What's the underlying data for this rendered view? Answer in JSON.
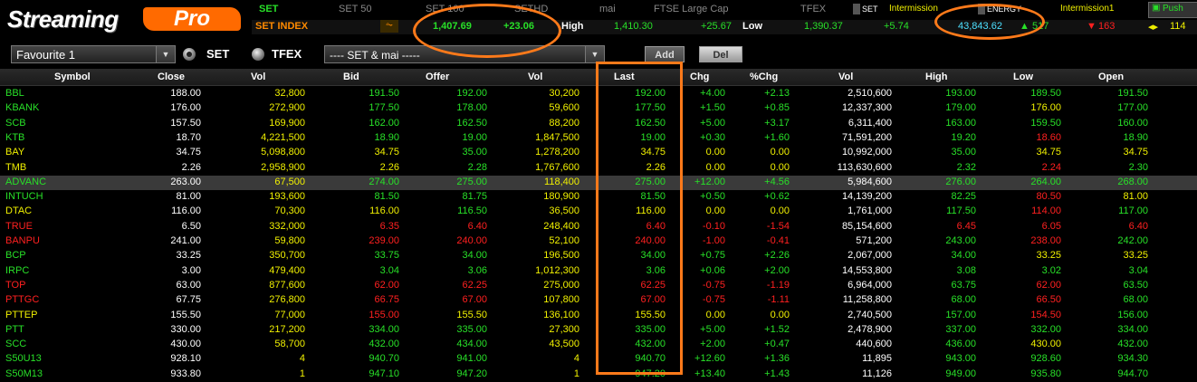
{
  "logo": {
    "word1": "Streaming",
    "word2": "Pro"
  },
  "index_tabs": [
    "SET",
    "SET 50",
    "SET 100",
    "SETHD",
    "mai",
    "FTSE Large Cap",
    "TFEX"
  ],
  "status_bar": {
    "set_label": "SET",
    "set_status": "Intermission",
    "sector_label": "ENERGY",
    "sector_status": "Intermission1",
    "push_label": "Push"
  },
  "index_row": {
    "name": "SET INDEX",
    "chart_icon": "line-chart-icon",
    "value": "1,407.69",
    "change": "+23.06",
    "high_label": "High",
    "high": "1,410.30",
    "high_chg": "+25.67",
    "low_label": "Low",
    "low": "1,390.37",
    "low_chg": "+5.74",
    "volume": "43,843.62",
    "up": "517",
    "down": "163",
    "unchanged": "114"
  },
  "controls": {
    "favourite": "Favourite 1",
    "radio_set": "SET",
    "radio_tfex": "TFEX",
    "market_filter": "---- SET & mai -----",
    "add": "Add",
    "del": "Del"
  },
  "columns": [
    "Symbol",
    "Close",
    "Vol",
    "Bid",
    "Offer",
    "Vol",
    "Last",
    "Chg",
    "%Chg",
    "Vol",
    "High",
    "Low",
    "Open"
  ],
  "rows": [
    [
      "BBL",
      "188.00",
      "32,800",
      "191.50",
      "192.00",
      "30,200",
      "192.00",
      "+4.00",
      "+2.13",
      "2,510,600",
      "193.00",
      "189.50",
      "191.50"
    ],
    [
      "KBANK",
      "176.00",
      "272,900",
      "177.50",
      "178.00",
      "59,600",
      "177.50",
      "+1.50",
      "+0.85",
      "12,337,300",
      "179.00",
      "176.00",
      "177.00"
    ],
    [
      "SCB",
      "157.50",
      "169,900",
      "162.00",
      "162.50",
      "88,200",
      "162.50",
      "+5.00",
      "+3.17",
      "6,311,400",
      "163.00",
      "159.50",
      "160.00"
    ],
    [
      "KTB",
      "18.70",
      "4,221,500",
      "18.90",
      "19.00",
      "1,847,500",
      "19.00",
      "+0.30",
      "+1.60",
      "71,591,200",
      "19.20",
      "18.60",
      "18.90"
    ],
    [
      "BAY",
      "34.75",
      "5,098,800",
      "34.75",
      "35.00",
      "1,278,200",
      "34.75",
      "0.00",
      "0.00",
      "10,992,000",
      "35.00",
      "34.75",
      "34.75"
    ],
    [
      "TMB",
      "2.26",
      "2,958,900",
      "2.26",
      "2.28",
      "1,767,600",
      "2.26",
      "0.00",
      "0.00",
      "113,630,600",
      "2.32",
      "2.24",
      "2.30"
    ],
    [
      "ADVANC",
      "263.00",
      "67,500",
      "274.00",
      "275.00",
      "118,400",
      "275.00",
      "+12.00",
      "+4.56",
      "5,984,600",
      "276.00",
      "264.00",
      "268.00"
    ],
    [
      "INTUCH",
      "81.00",
      "193,600",
      "81.50",
      "81.75",
      "180,900",
      "81.50",
      "+0.50",
      "+0.62",
      "14,139,200",
      "82.25",
      "80.50",
      "81.00"
    ],
    [
      "DTAC",
      "116.00",
      "70,300",
      "116.00",
      "116.50",
      "36,500",
      "116.00",
      "0.00",
      "0.00",
      "1,761,000",
      "117.50",
      "114.00",
      "117.00"
    ],
    [
      "TRUE",
      "6.50",
      "332,000",
      "6.35",
      "6.40",
      "248,400",
      "6.40",
      "-0.10",
      "-1.54",
      "85,154,600",
      "6.45",
      "6.05",
      "6.40"
    ],
    [
      "BANPU",
      "241.00",
      "59,800",
      "239.00",
      "240.00",
      "52,100",
      "240.00",
      "-1.00",
      "-0.41",
      "571,200",
      "243.00",
      "238.00",
      "242.00"
    ],
    [
      "BCP",
      "33.25",
      "350,700",
      "33.75",
      "34.00",
      "196,500",
      "34.00",
      "+0.75",
      "+2.26",
      "2,067,000",
      "34.00",
      "33.25",
      "33.25"
    ],
    [
      "IRPC",
      "3.00",
      "479,400",
      "3.04",
      "3.06",
      "1,012,300",
      "3.06",
      "+0.06",
      "+2.00",
      "14,553,800",
      "3.08",
      "3.02",
      "3.04"
    ],
    [
      "TOP",
      "63.00",
      "877,600",
      "62.00",
      "62.25",
      "275,000",
      "62.25",
      "-0.75",
      "-1.19",
      "6,964,000",
      "63.75",
      "62.00",
      "63.50"
    ],
    [
      "PTTGC",
      "67.75",
      "276,800",
      "66.75",
      "67.00",
      "107,800",
      "67.00",
      "-0.75",
      "-1.11",
      "11,258,800",
      "68.00",
      "66.50",
      "68.00"
    ],
    [
      "PTTEP",
      "155.50",
      "77,000",
      "155.00",
      "155.50",
      "136,100",
      "155.50",
      "0.00",
      "0.00",
      "2,740,500",
      "157.00",
      "154.50",
      "156.00"
    ],
    [
      "PTT",
      "330.00",
      "217,200",
      "334.00",
      "335.00",
      "27,300",
      "335.00",
      "+5.00",
      "+1.52",
      "2,478,900",
      "337.00",
      "332.00",
      "334.00"
    ],
    [
      "SCC",
      "430.00",
      "58,700",
      "432.00",
      "434.00",
      "43,500",
      "432.00",
      "+2.00",
      "+0.47",
      "440,600",
      "436.00",
      "430.00",
      "432.00"
    ],
    [
      "S50U13",
      "928.10",
      "4",
      "940.70",
      "941.00",
      "4",
      "940.70",
      "+12.60",
      "+1.36",
      "11,895",
      "943.00",
      "928.60",
      "934.30"
    ],
    [
      "S50M13",
      "933.80",
      "1",
      "947.10",
      "947.20",
      "1",
      "947.20",
      "+13.40",
      "+1.43",
      "11,126",
      "949.00",
      "935.80",
      "944.70"
    ]
  ],
  "selected_row": "ADVANC",
  "colors": {
    "up": "#28e028",
    "down": "#ff2020",
    "flat": "#f0f000",
    "neutral": "#ffffff",
    "highlight": "#ff7a1a"
  }
}
